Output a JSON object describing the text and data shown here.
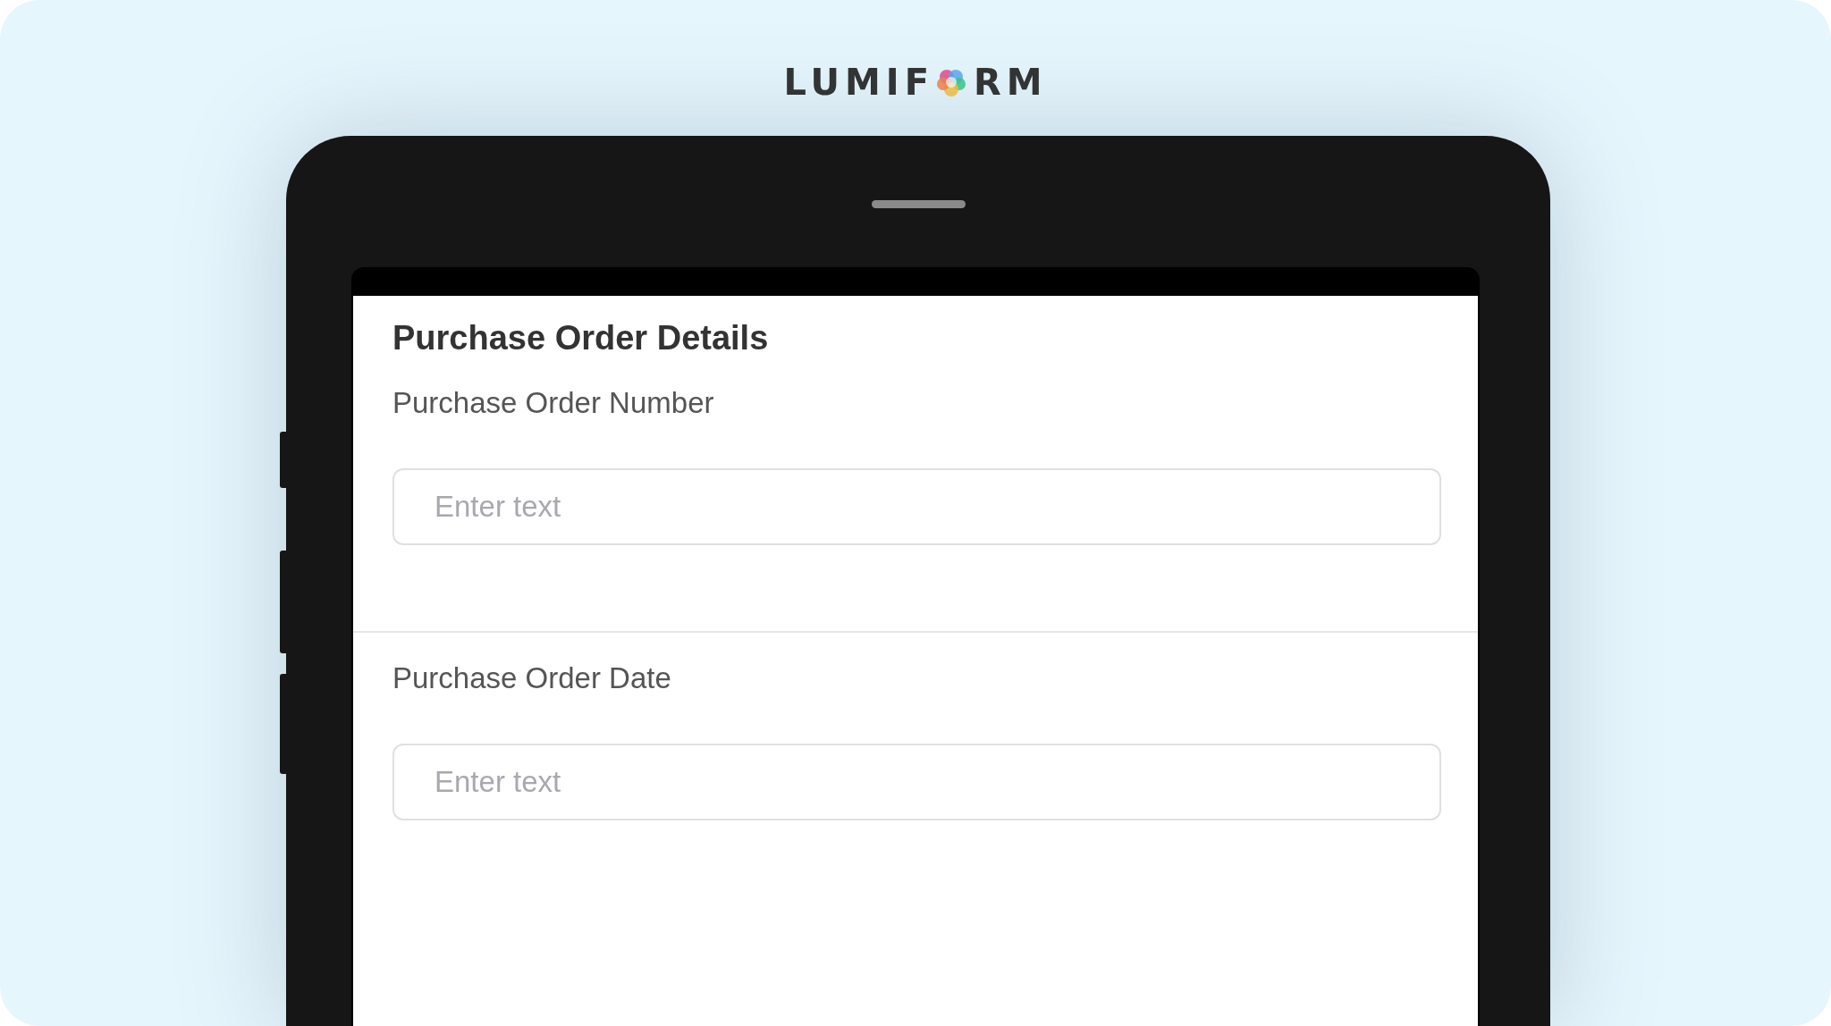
{
  "logo": {
    "left": "LUMIF",
    "right": "RM"
  },
  "form": {
    "title": "Purchase Order Details",
    "sections": [
      {
        "label": "Purchase Order Number",
        "placeholder": "Enter text"
      },
      {
        "label": "Purchase Order Date",
        "placeholder": "Enter text"
      }
    ]
  }
}
